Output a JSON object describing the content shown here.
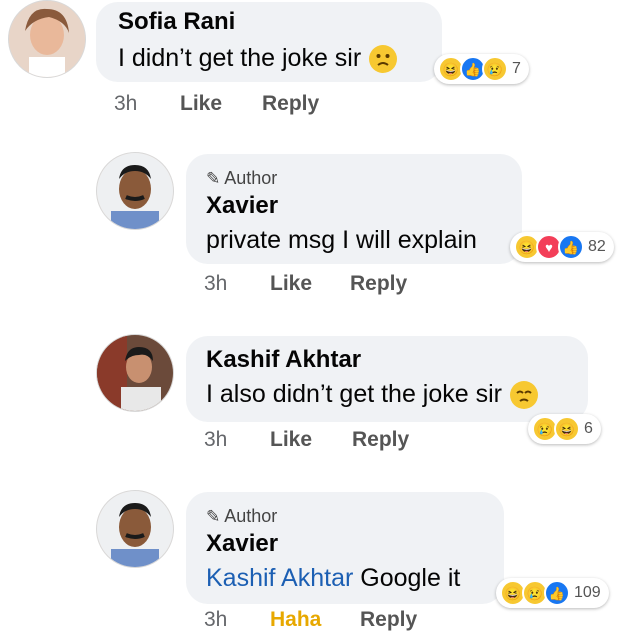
{
  "comments": [
    {
      "name": "Sofia Rani",
      "text": "I didn’t get the joke sir",
      "time": "3h",
      "like": "Like",
      "reply": "Reply",
      "reaction_count": "7"
    },
    {
      "author_tag": "Author",
      "name": "Xavier",
      "text": "private msg I will explain",
      "time": "3h",
      "like": "Like",
      "reply": "Reply",
      "reaction_count": "82"
    },
    {
      "name": "Kashif Akhtar",
      "text": "I also didn’t get the joke sir",
      "time": "3h",
      "like": "Like",
      "reply": "Reply",
      "reaction_count": "6"
    },
    {
      "author_tag": "Author",
      "name": "Xavier",
      "mention": "Kashif Akhtar",
      "text": "Google it",
      "time": "3h",
      "like": "Haha",
      "reply": "Reply",
      "reaction_count": "109"
    }
  ],
  "icons": {
    "author": "pencil-icon",
    "reactions": [
      "haha-reaction-icon",
      "like-reaction-icon",
      "love-reaction-icon",
      "sad-reaction-icon"
    ]
  },
  "colors": {
    "bubble": "#f0f2f5",
    "mention": "#1c5fb3",
    "haha_active": "#e7a800",
    "like_blue": "#1877f2",
    "love_red": "#f33e58"
  }
}
